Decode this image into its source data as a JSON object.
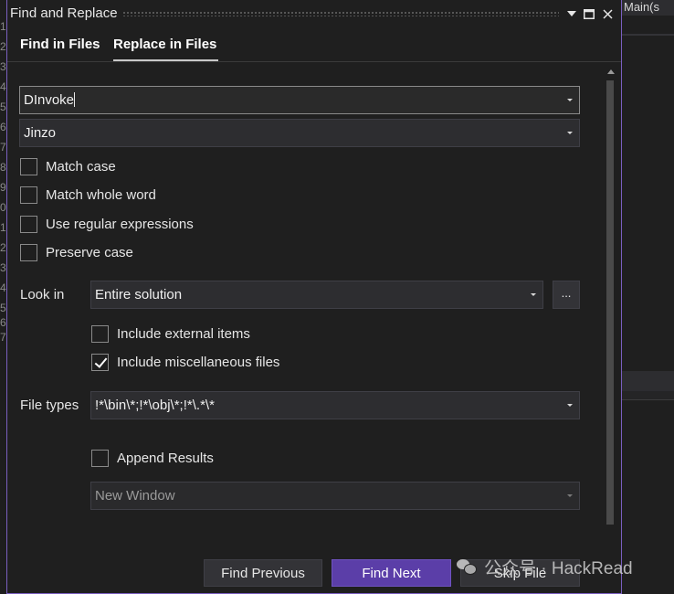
{
  "background": {
    "gutter_digits": [
      "1",
      "2",
      "3",
      "4",
      "5",
      "6",
      "7",
      "8",
      "9",
      "0",
      "1",
      "2",
      "3",
      "4",
      "5",
      "6",
      "7"
    ],
    "right_tab_label": "Main(s"
  },
  "dialog": {
    "title": "Find and Replace",
    "tabs": [
      {
        "label": "Find in Files"
      },
      {
        "label": "Replace in Files",
        "active": true
      }
    ],
    "find_what": {
      "value": "DInvoke"
    },
    "replace_with": {
      "value": "Jinzo"
    },
    "options": [
      {
        "label": "Match case",
        "checked": false
      },
      {
        "label": "Match whole word",
        "checked": false
      },
      {
        "label": "Use regular expressions",
        "checked": false
      },
      {
        "label": "Preserve case",
        "checked": false
      }
    ],
    "look_in": {
      "label": "Look in",
      "value": "Entire solution",
      "browse_label": "..."
    },
    "look_in_options": [
      {
        "label": "Include external items",
        "checked": false
      },
      {
        "label": "Include miscellaneous files",
        "checked": true
      }
    ],
    "file_types": {
      "label": "File types",
      "value": "!*\\bin\\*;!*\\obj\\*;!*\\.*\\*"
    },
    "append_results": {
      "label": "Append Results",
      "checked": false
    },
    "results_window": {
      "value": "New Window"
    },
    "buttons": {
      "find_previous": "Find Previous",
      "find_next": "Find Next",
      "skip_file": "Skip File"
    }
  },
  "watermark": {
    "text": "公众号 · HackRead"
  },
  "colors": {
    "accent": "#5b3ea8",
    "dialog_border": "#7a5fc0",
    "background": "#1f1f1f"
  }
}
